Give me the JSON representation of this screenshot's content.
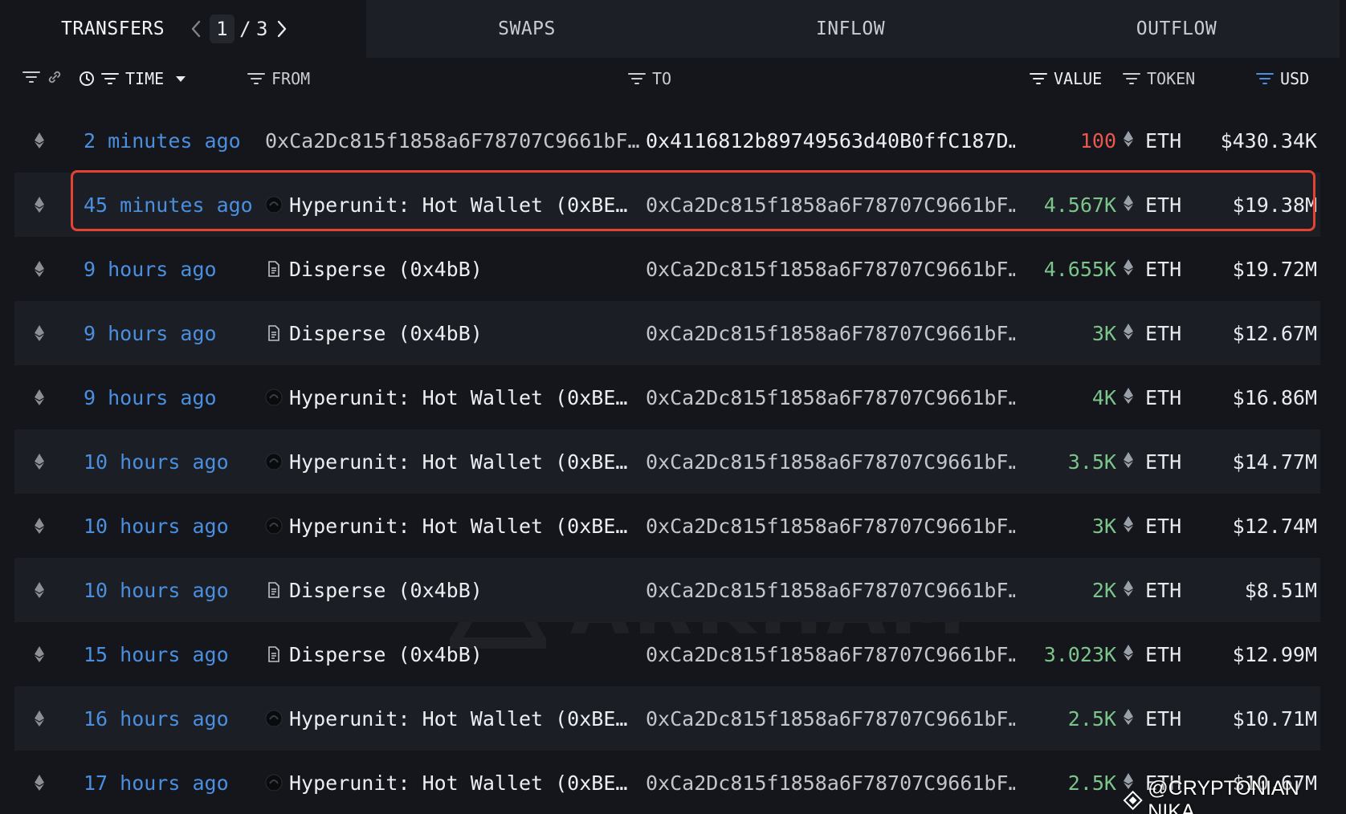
{
  "tabs": {
    "transfers": "TRANSFERS",
    "page_current": "1",
    "page_sep": "/",
    "page_total": "3",
    "swaps": "SWAPS",
    "inflow": "INFLOW",
    "outflow": "OUTFLOW"
  },
  "columns": {
    "time": "TIME",
    "from": "FROM",
    "to": "TO",
    "value": "VALUE",
    "token": "TOKEN",
    "usd": "USD"
  },
  "rows": [
    {
      "time": "2 minutes ago",
      "from": "0xCa2Dc815f1858a6F78707C9661bF…",
      "from_type": "address",
      "to": "0x4116812b89749563d40B0ffC187D…",
      "value": "100",
      "value_color": "red",
      "token": "ETH",
      "usd": "$430.34K"
    },
    {
      "time": "45 minutes ago",
      "from": "Hyperunit: Hot Wallet (0xBE…",
      "from_type": "entity",
      "to": "0xCa2Dc815f1858a6F78707C9661bF…",
      "value": "4.567K",
      "value_color": "green",
      "token": "ETH",
      "usd": "$19.38M"
    },
    {
      "time": "9 hours ago",
      "from": "Disperse (0x4bB)",
      "from_type": "contract",
      "to": "0xCa2Dc815f1858a6F78707C9661bF…",
      "value": "4.655K",
      "value_color": "green",
      "token": "ETH",
      "usd": "$19.72M"
    },
    {
      "time": "9 hours ago",
      "from": "Disperse (0x4bB)",
      "from_type": "contract",
      "to": "0xCa2Dc815f1858a6F78707C9661bF…",
      "value": "3K",
      "value_color": "green",
      "token": "ETH",
      "usd": "$12.67M"
    },
    {
      "time": "9 hours ago",
      "from": "Hyperunit: Hot Wallet (0xBE…",
      "from_type": "entity",
      "to": "0xCa2Dc815f1858a6F78707C9661bF…",
      "value": "4K",
      "value_color": "green",
      "token": "ETH",
      "usd": "$16.86M"
    },
    {
      "time": "10 hours ago",
      "from": "Hyperunit: Hot Wallet (0xBE…",
      "from_type": "entity",
      "to": "0xCa2Dc815f1858a6F78707C9661bF…",
      "value": "3.5K",
      "value_color": "green",
      "token": "ETH",
      "usd": "$14.77M"
    },
    {
      "time": "10 hours ago",
      "from": "Hyperunit: Hot Wallet (0xBE…",
      "from_type": "entity",
      "to": "0xCa2Dc815f1858a6F78707C9661bF…",
      "value": "3K",
      "value_color": "green",
      "token": "ETH",
      "usd": "$12.74M"
    },
    {
      "time": "10 hours ago",
      "from": "Disperse (0x4bB)",
      "from_type": "contract",
      "to": "0xCa2Dc815f1858a6F78707C9661bF…",
      "value": "2K",
      "value_color": "green",
      "token": "ETH",
      "usd": "$8.51M"
    },
    {
      "time": "15 hours ago",
      "from": "Disperse (0x4bB)",
      "from_type": "contract",
      "to": "0xCa2Dc815f1858a6F78707C9661bF…",
      "value": "3.023K",
      "value_color": "green",
      "token": "ETH",
      "usd": "$12.99M"
    },
    {
      "time": "16 hours ago",
      "from": "Hyperunit: Hot Wallet (0xBE…",
      "from_type": "entity",
      "to": "0xCa2Dc815f1858a6F78707C9661bF…",
      "value": "2.5K",
      "value_color": "green",
      "token": "ETH",
      "usd": "$10.71M"
    },
    {
      "time": "17 hours ago",
      "from": "Hyperunit: Hot Wallet (0xBE…",
      "from_type": "entity",
      "to": "0xCa2Dc815f1858a6F78707C9661bF…",
      "value": "2.5K",
      "value_color": "green",
      "token": "ETH",
      "usd": "$10.67M"
    }
  ],
  "watermark": "ARKHAM",
  "credit": "@CRYPTONIAN NIKA",
  "colors": {
    "time_link": "#4a8fe0",
    "value_green": "#7cc58a",
    "value_red": "#e8584f",
    "highlight_border": "#e24332"
  },
  "icons": {
    "chain": "ethereum-icon",
    "token": "ethereum-icon",
    "entity": "hyperunit-logo-icon",
    "contract": "contract-document-icon"
  }
}
